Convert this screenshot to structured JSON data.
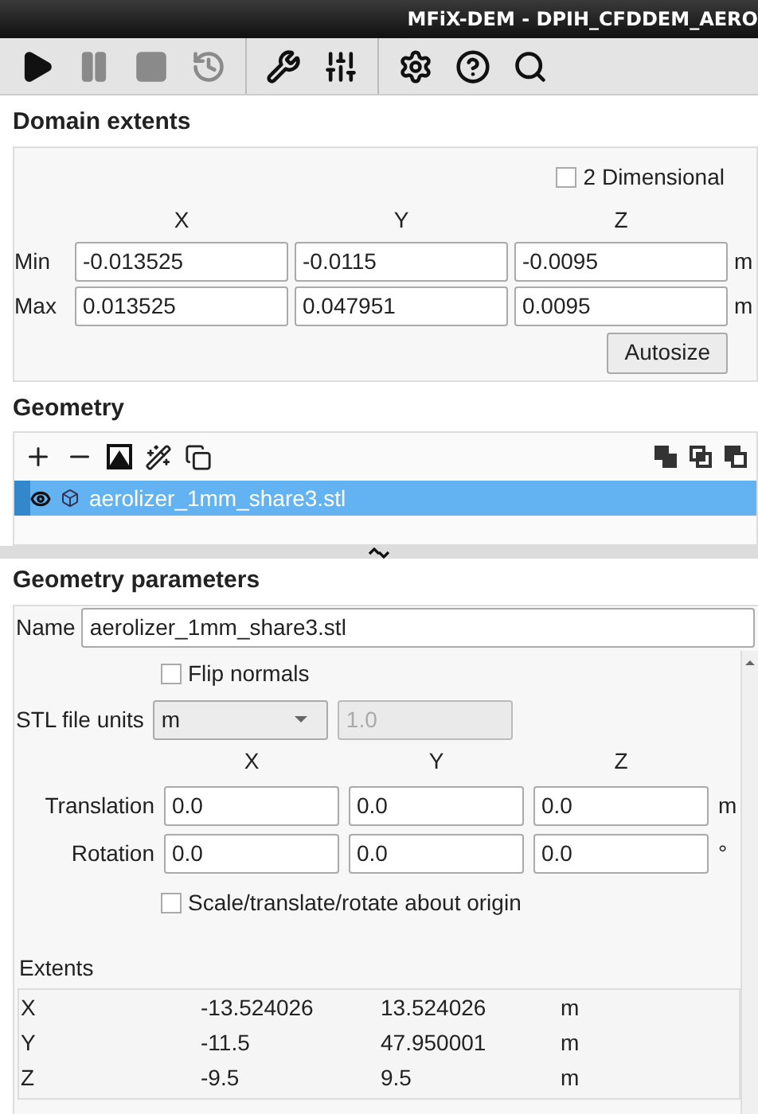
{
  "window": {
    "title": "MFiX-DEM - DPIH_CFDDEM_AERO"
  },
  "toolbar": [
    [
      {
        "kind": "play",
        "disabled": false
      },
      {
        "kind": "pause",
        "disabled": true
      },
      {
        "kind": "stop",
        "disabled": true
      },
      {
        "kind": "reset",
        "disabled": true
      }
    ],
    [
      {
        "kind": "wrench",
        "disabled": false
      },
      {
        "kind": "sliders",
        "disabled": false
      }
    ],
    [
      {
        "kind": "settings",
        "disabled": false
      },
      {
        "kind": "help",
        "disabled": false
      },
      {
        "kind": "search",
        "disabled": false
      }
    ]
  ],
  "domain_extents": {
    "title": "Domain extents",
    "two_dimensional": {
      "label": "2 Dimensional",
      "checked": false
    },
    "columns": [
      "X",
      "Y",
      "Z"
    ],
    "rows": [
      {
        "label": "Min",
        "values": [
          "-0.013525",
          "-0.0115",
          "-0.0095"
        ],
        "unit": "m"
      },
      {
        "label": "Max",
        "values": [
          "0.013525",
          "0.047951",
          "0.0095"
        ],
        "unit": "m"
      }
    ],
    "autosize_button": "Autosize"
  },
  "geometry": {
    "title": "Geometry",
    "items": [
      {
        "name": "aerolizer_1mm_share3.stl",
        "visible": true,
        "selected": true
      }
    ]
  },
  "geometry_parameters": {
    "title": "Geometry parameters",
    "name_label": "Name",
    "name_value": "aerolizer_1mm_share3.stl",
    "flip_normals": {
      "label": "Flip normals",
      "checked": false
    },
    "stl_units": {
      "label": "STL file units",
      "value": "m",
      "scale": "1.0",
      "scale_disabled": true
    },
    "columns": [
      "X",
      "Y",
      "Z"
    ],
    "rows": [
      {
        "label": "Translation",
        "values": [
          "0.0",
          "0.0",
          "0.0"
        ],
        "unit": "m"
      },
      {
        "label": "Rotation",
        "values": [
          "0.0",
          "0.0",
          "0.0"
        ],
        "unit": "°"
      }
    ],
    "about_origin": {
      "label": "Scale/translate/rotate about origin",
      "checked": false
    },
    "extents_title": "Extents",
    "extents": [
      [
        "X",
        "-13.524026",
        "13.524026",
        "m"
      ],
      [
        "Y",
        "-11.5",
        "47.950001",
        "m"
      ],
      [
        "Z",
        "-9.5",
        "9.5",
        "m"
      ]
    ]
  }
}
